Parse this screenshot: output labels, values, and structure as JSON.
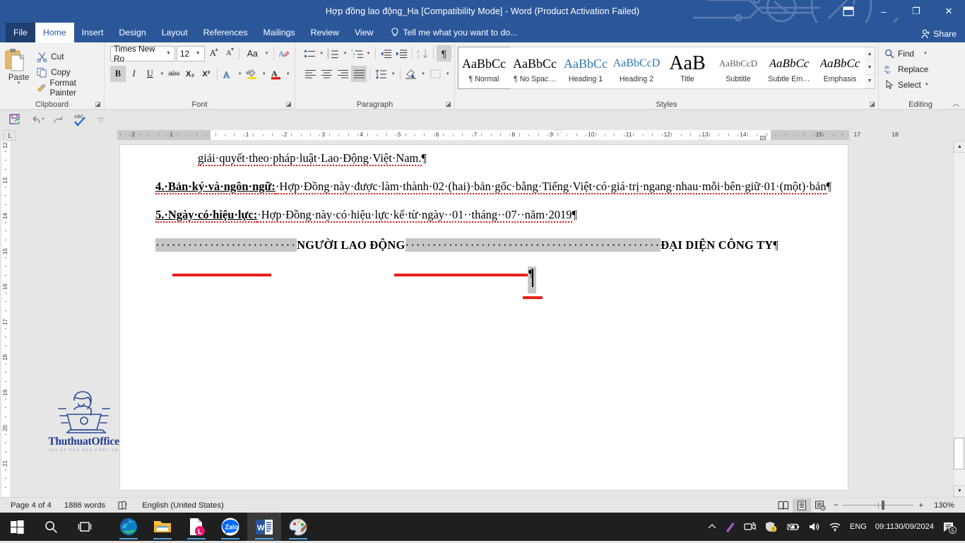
{
  "titlebar": {
    "title": "Hợp đồng lao động_Ha [Compatibility Mode] - Word (Product Activation Failed)",
    "ribbon_display_options": "ribbon-display-options",
    "minimize": "–",
    "restore": "❐",
    "close": "✕",
    "accent_color": "#2b579a"
  },
  "tabs": [
    {
      "label": "File",
      "kind": "file"
    },
    {
      "label": "Home",
      "kind": "active"
    },
    {
      "label": "Insert",
      "kind": "normal"
    },
    {
      "label": "Design",
      "kind": "normal"
    },
    {
      "label": "Layout",
      "kind": "normal"
    },
    {
      "label": "References",
      "kind": "normal"
    },
    {
      "label": "Mailings",
      "kind": "normal"
    },
    {
      "label": "Review",
      "kind": "normal"
    },
    {
      "label": "View",
      "kind": "normal"
    }
  ],
  "tellme": {
    "label": "Tell me what you want to do..."
  },
  "share": {
    "label": "Share"
  },
  "ribbon": {
    "clipboard": {
      "group_label": "Clipboard",
      "paste_label": "Paste",
      "items": [
        {
          "label": "Cut",
          "icon": "scissors-icon"
        },
        {
          "label": "Copy",
          "icon": "copy-icon"
        },
        {
          "label": "Format Painter",
          "icon": "format-painter-icon"
        }
      ]
    },
    "font": {
      "group_label": "Font",
      "font_name": "Times New Ro",
      "font_size": "12",
      "grow_font": "A",
      "shrink_font": "A",
      "change_case": "Aa",
      "clear_formatting": "clear-formatting-icon",
      "bold": "B",
      "italic": "I",
      "underline": "U",
      "strikethrough": "abc",
      "subscript": "X₂",
      "superscript": "X²",
      "text_effects": "A",
      "highlight": "ab",
      "font_color": "A"
    },
    "paragraph": {
      "group_label": "Paragraph",
      "bullets": "bullets-icon",
      "numbering": "numbering-icon",
      "multilevel": "multilevel-list-icon",
      "decrease_indent": "decrease-indent-icon",
      "increase_indent": "increase-indent-icon",
      "sort": "sort-icon",
      "show_marks": "¶",
      "align_left": "align-left-icon",
      "align_center": "align-center-icon",
      "align_right": "align-right-icon",
      "justify": "justify-icon",
      "line_spacing": "line-spacing-icon",
      "shading": "shading-icon",
      "borders": "borders-icon"
    },
    "styles": {
      "group_label": "Styles",
      "items": [
        {
          "preview": "AaBbCc",
          "name": "¶ Normal",
          "selected": true,
          "color": "#000000",
          "size": 18,
          "italic": false,
          "bold": false
        },
        {
          "preview": "AaBbCc",
          "name": "¶ No Spac…",
          "selected": false,
          "color": "#000000",
          "size": 18,
          "italic": false,
          "bold": false
        },
        {
          "preview": "AaBbCc",
          "name": "Heading 1",
          "selected": false,
          "color": "#2e74b5",
          "size": 18,
          "italic": false,
          "bold": false
        },
        {
          "preview": "AaBbCcD",
          "name": "Heading 2",
          "selected": false,
          "color": "#2e74b5",
          "size": 16,
          "italic": false,
          "bold": false
        },
        {
          "preview": "AaB",
          "name": "Title",
          "selected": false,
          "color": "#000000",
          "size": 28,
          "italic": false,
          "bold": false
        },
        {
          "preview": "AaBbCcD",
          "name": "Subtitle",
          "selected": false,
          "color": "#5a5a5a",
          "size": 13,
          "italic": false,
          "bold": false
        },
        {
          "preview": "AaBbCc",
          "name": "Subtle Em…",
          "selected": false,
          "color": "#000000",
          "size": 17,
          "italic": true,
          "bold": false
        },
        {
          "preview": "AaBbCc",
          "name": "Emphasis",
          "selected": false,
          "color": "#000000",
          "size": 17,
          "italic": true,
          "bold": false
        }
      ]
    },
    "editing": {
      "group_label": "Editing",
      "items": [
        {
          "label": "Find",
          "icon": "search-icon",
          "caret": true
        },
        {
          "label": "Replace",
          "icon": "replace-icon",
          "caret": false
        },
        {
          "label": "Select",
          "icon": "cursor-icon",
          "caret": true
        }
      ]
    }
  },
  "qat": {
    "save": "save-icon",
    "undo": "undo-icon",
    "redo": "redo-icon",
    "spelling": "spelling-check-icon",
    "customize": "customize-qat-icon"
  },
  "ruler": {
    "corner_tab_stop": "L",
    "h_labels": [
      "2",
      "1",
      "1",
      "2",
      "3",
      "4",
      "5",
      "6",
      "7",
      "8",
      "9",
      "10",
      "11",
      "12",
      "13",
      "14",
      "15",
      "17",
      "18"
    ],
    "v_labels": [
      "12",
      "13",
      "14",
      "15",
      "16",
      "17",
      "18",
      "19",
      "20",
      "21"
    ]
  },
  "document": {
    "paragraphs": [
      {
        "id": "p-continuation",
        "indent": 60,
        "runs": [
          {
            "t": "giải quyết theo pháp luật Lao Động Việt Nam.",
            "b": false,
            "u": false,
            "spell": true
          },
          {
            "t": "¶",
            "b": false,
            "u": false,
            "spell": false
          }
        ]
      },
      {
        "id": "p-clause-4",
        "indent": 0,
        "runs": [
          {
            "t": "4. Bản ký và ngôn ngữ:",
            "b": true,
            "u": true,
            "spell": true
          },
          {
            "t": " Hợp Đồng này được làm thành 02 (hai) bản gốc bằng Tiếng Việt có giá trị ngang nhau mỗi bên giữ 01 (một) bản",
            "b": false,
            "u": false,
            "spell": true
          },
          {
            "t": "¶",
            "b": false,
            "u": false,
            "spell": false
          }
        ]
      },
      {
        "id": "p-clause-5",
        "indent": 0,
        "runs": [
          {
            "t": "5. Ngày có hiệu lực:",
            "b": true,
            "u": true,
            "spell": true
          },
          {
            "t": " Hợp Đồng này có hiệu lực kể từ ngày  01  tháng  07  năm 2019",
            "b": false,
            "u": false,
            "spell": true
          },
          {
            "t": "¶",
            "b": false,
            "u": false,
            "spell": false
          }
        ]
      }
    ],
    "signature_line": {
      "leader_1": "··························",
      "label_1": "NGƯỜI LAO ĐỘNG",
      "leader_2": "···············································",
      "label_2": "ĐẠI DIỆN CÔNG TY",
      "pilcrow": "¶"
    },
    "annotations": {
      "red_underline_left": "red-highlight-line-left",
      "red_underline_right": "red-highlight-line-right",
      "red_underline_small": "red-highlight-line-small"
    },
    "watermark": {
      "brand": "ThuthuatOffice",
      "tagline": "TRI KỶ CỦA DÂN CÔNG SỞ"
    }
  },
  "statusbar": {
    "page": "Page 4 of 4",
    "words": "1886 words",
    "proofing_icon": "proofing-errors-icon",
    "language": "English (United States)",
    "views": [
      {
        "name": "read-mode-view",
        "active": false
      },
      {
        "name": "print-layout-view",
        "active": true
      },
      {
        "name": "web-layout-view",
        "active": false
      }
    ],
    "zoom_out": "−",
    "zoom_in": "+",
    "zoom_level": "130%"
  },
  "taskbar": {
    "start": "start-icon",
    "search": "search-icon",
    "taskview": "task-view-icon",
    "apps": [
      {
        "name": "edge-icon",
        "running": true,
        "active": false
      },
      {
        "name": "file-explorer-icon",
        "running": true,
        "active": false
      },
      {
        "name": "lastpass-icon",
        "running": true,
        "active": false
      },
      {
        "name": "zalo-icon",
        "running": true,
        "active": false
      },
      {
        "name": "word-icon",
        "running": true,
        "active": true
      },
      {
        "name": "paint-icon",
        "running": true,
        "active": false
      }
    ],
    "tray": {
      "show_hidden": "chevron-up-icon",
      "pen": "pen-icon",
      "camera": "camera-icon",
      "security": "security-warning-icon",
      "battery_charging": "battery-charging-icon",
      "volume": "volume-icon",
      "network": "wifi-icon",
      "language": "ENG",
      "time": "09:11",
      "date": "30/09/2024",
      "notifications": "notifications-icon",
      "notification_count": "5"
    }
  }
}
